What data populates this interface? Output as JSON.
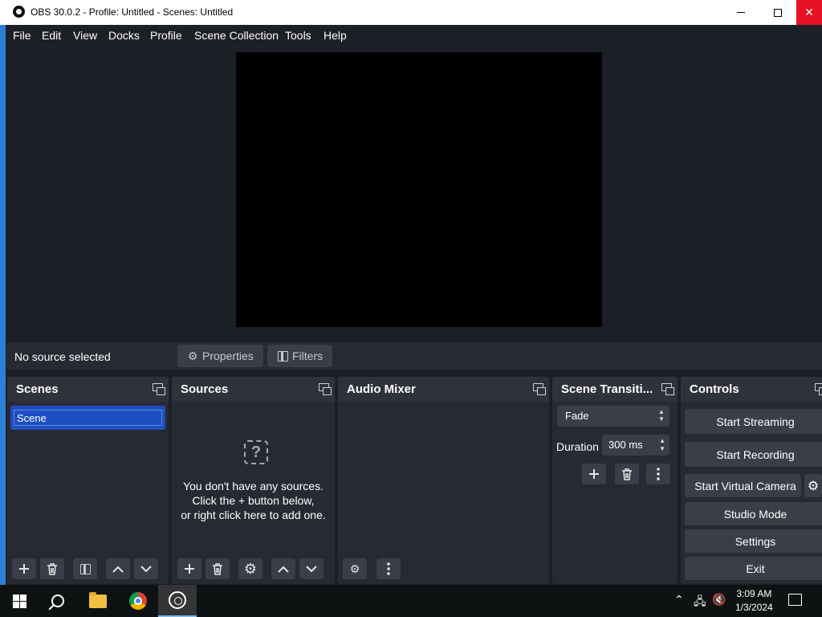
{
  "titlebar": {
    "title": "OBS 30.0.2 - Profile: Untitled - Scenes: Untitled",
    "close_glyph": "✕"
  },
  "menu": [
    "File",
    "Edit",
    "View",
    "Docks",
    "Profile",
    "Scene Collection",
    "Tools",
    "Help"
  ],
  "source_bar": {
    "status": "No source selected",
    "properties_label": "Properties",
    "filters_label": "Filters"
  },
  "docks": {
    "scenes": {
      "title": "Scenes",
      "items": [
        "Scene"
      ]
    },
    "sources": {
      "title": "Sources",
      "empty_icon_glyph": "?",
      "empty_line1": "You don't have any sources.",
      "empty_line2": "Click the + button below,",
      "empty_line3": "or right click here to add one."
    },
    "audio_mixer": {
      "title": "Audio Mixer"
    },
    "transitions": {
      "title": "Scene Transiti...",
      "selected": "Fade",
      "duration_label": "Duration",
      "duration_value": "300 ms"
    },
    "controls": {
      "title": "Controls",
      "start_streaming": "Start Streaming",
      "start_recording": "Start Recording",
      "start_virtual_camera": "Start Virtual Camera",
      "studio_mode": "Studio Mode",
      "settings": "Settings",
      "exit": "Exit"
    }
  },
  "taskbar": {
    "time": "3:09 AM",
    "date": "1/3/2024"
  },
  "colors": {
    "window_bg": "#1d1f26",
    "dock_bg": "#272a33",
    "button_bg": "#3b3e48",
    "selection": "#1d4fc2",
    "close_red": "#e81123"
  }
}
